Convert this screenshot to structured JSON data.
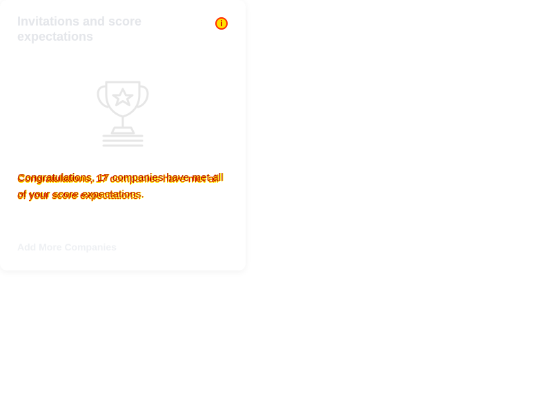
{
  "card": {
    "title": "Invitations and score expectations",
    "info_icon": "info-icon",
    "illustration_icon": "trophy-icon",
    "message": "Congratulations, 17 companies have met all of your score expectations.",
    "add_more_label": "Add More Companies"
  },
  "colors": {
    "card_background": "#ffffff",
    "title": "#e4e6ea",
    "message_primary": "#d80000",
    "message_highlight": "#ffef00",
    "trophy_stroke": "#e6e6e6",
    "add_more": "#eef0f3"
  }
}
